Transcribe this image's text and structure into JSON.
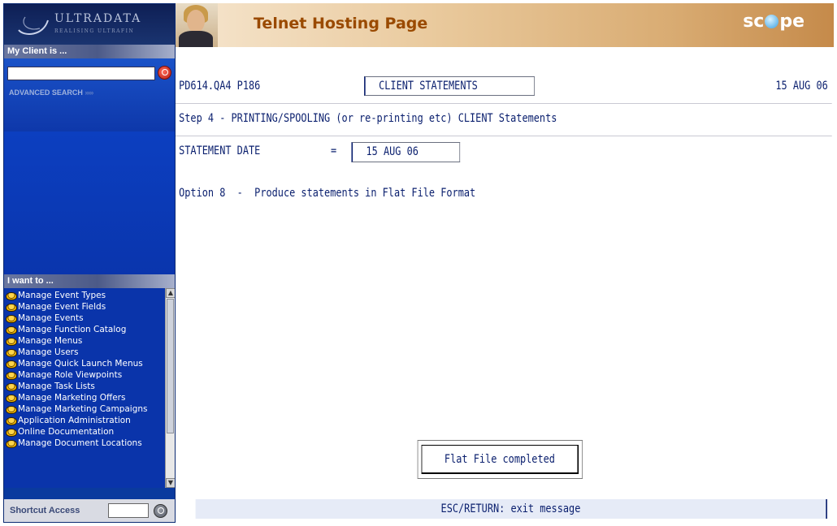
{
  "sidebar": {
    "logo": {
      "name": "ULTRADATA",
      "tagline": "REALISING ULTRAFIN"
    },
    "client_section": {
      "header": "My Client is ...",
      "search_value": "",
      "advanced_search_label": "ADVANCED SEARCH",
      "advanced_search_arrows": "›››››"
    },
    "iwant_section": {
      "header": "I want to ...",
      "items": [
        {
          "label": "Manage Event Types"
        },
        {
          "label": "Manage Event Fields"
        },
        {
          "label": "Manage Events"
        },
        {
          "label": "Manage Function Catalog"
        },
        {
          "label": "Manage Menus"
        },
        {
          "label": "Manage Users"
        },
        {
          "label": "Manage Quick Launch Menus"
        },
        {
          "label": "Manage Role Viewpoints"
        },
        {
          "label": "Manage Task Lists"
        },
        {
          "label": "Manage Marketing Offers"
        },
        {
          "label": "Manage Marketing Campaigns"
        },
        {
          "label": "Application Administration"
        },
        {
          "label": "Online Documentation"
        },
        {
          "label": "Manage Document Locations"
        }
      ]
    },
    "shortcut": {
      "label": "Shortcut Access",
      "value": ""
    }
  },
  "header": {
    "title": "Telnet Hosting Page",
    "brand_before": "sc",
    "brand_after": "pe"
  },
  "terminal": {
    "program_id": "PD614.QA4 P186",
    "screen_name": "CLIENT STATEMENTS",
    "date": "15 AUG 06",
    "step_text": "Step 4 - PRINTING/SPOOLING (or re-printing etc) CLIENT Statements",
    "statement_date_label": "STATEMENT DATE",
    "statement_date_equals": "=",
    "statement_date_value": "15 AUG 06",
    "option_text": "Option 8  -  Produce statements in Flat File Format",
    "message": "Flat File completed",
    "status": "ESC/RETURN: exit message"
  },
  "colors": {
    "sidebar_blue": "#0a3a9e",
    "terminal_text": "#0a1f6e",
    "header_title": "#9a4a00"
  }
}
